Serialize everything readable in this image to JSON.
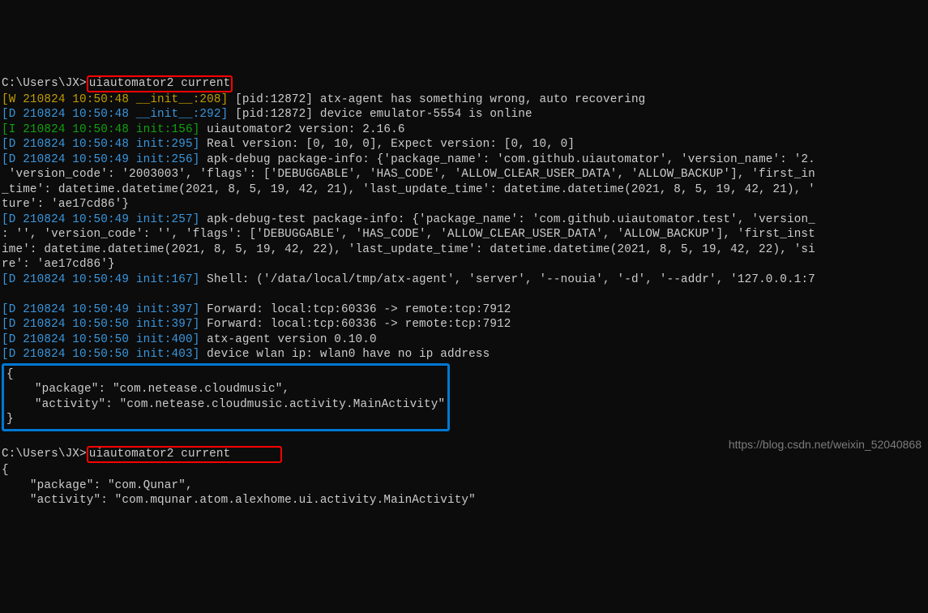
{
  "prompt1_path": "C:\\Users\\JX>",
  "prompt1_cmd": "uiautomator2 current",
  "line1_prefix": "[W 210824 10:50:48 __init__:208]",
  "line1_body": " [pid:12872] atx-agent has something wrong, auto recovering",
  "line2_prefix": "[D 210824 10:50:48 __init__:292]",
  "line2_body": " [pid:12872] device emulator-5554 is online",
  "line3_prefix": "[I 210824 10:50:48 init:156]",
  "line3_body": " uiautomator2 version: 2.16.6",
  "line4_prefix": "[D 210824 10:50:48 init:295]",
  "line4_body": " Real version: [0, 10, 0], Expect version: [0, 10, 0]",
  "line5_prefix": "[D 210824 10:50:49 init:256]",
  "line5_body": " apk-debug package-info: {'package_name': 'com.github.uiautomator', 'version_name': '2.",
  "line5_cont1": " 'version_code': '2003003', 'flags': ['DEBUGGABLE', 'HAS_CODE', 'ALLOW_CLEAR_USER_DATA', 'ALLOW_BACKUP'], 'first_in",
  "line5_cont2": "_time': datetime.datetime(2021, 8, 5, 19, 42, 21), 'last_update_time': datetime.datetime(2021, 8, 5, 19, 42, 21), '",
  "line5_cont3": "ture': 'ae17cd86'}",
  "line6_prefix": "[D 210824 10:50:49 init:257]",
  "line6_body": " apk-debug-test package-info: {'package_name': 'com.github.uiautomator.test', 'version_",
  "line6_cont1": ": '', 'version_code': '', 'flags': ['DEBUGGABLE', 'HAS_CODE', 'ALLOW_CLEAR_USER_DATA', 'ALLOW_BACKUP'], 'first_inst",
  "line6_cont2": "ime': datetime.datetime(2021, 8, 5, 19, 42, 22), 'last_update_time': datetime.datetime(2021, 8, 5, 19, 42, 22), 'si",
  "line6_cont3": "re': 'ae17cd86'}",
  "line7_prefix": "[D 210824 10:50:49 init:167]",
  "line7_body": " Shell: ('/data/local/tmp/atx-agent', 'server', '--nouia', '-d', '--addr', '127.0.0.1:7",
  "line8_prefix": "[D 210824 10:50:49 init:397]",
  "line8_body": " Forward: local:tcp:60336 -> remote:tcp:7912",
  "line9_prefix": "[D 210824 10:50:50 init:397]",
  "line9_body": " Forward: local:tcp:60336 -> remote:tcp:7912",
  "line10_prefix": "[D 210824 10:50:50 init:400]",
  "line10_body": " atx-agent version 0.10.0",
  "line11_prefix": "[D 210824 10:50:50 init:403]",
  "line11_body": " device wlan ip: wlan0 have no ip address",
  "json1_open": "{",
  "json1_l1": "    \"package\": \"com.netease.cloudmusic\",",
  "json1_l2": "    \"activity\": \"com.netease.cloudmusic.activity.MainActivity\"",
  "json1_close": "}",
  "prompt2_path": "C:\\Users\\JX>",
  "prompt2_cmd": "uiautomator2 current       ",
  "json2_open": "{",
  "json2_l1": "    \"package\": \"com.Qunar\",",
  "json2_l2": "    \"activity\": \"com.mqunar.atom.alexhome.ui.activity.MainActivity\"",
  "watermark": "https://blog.csdn.net/weixin_52040868"
}
